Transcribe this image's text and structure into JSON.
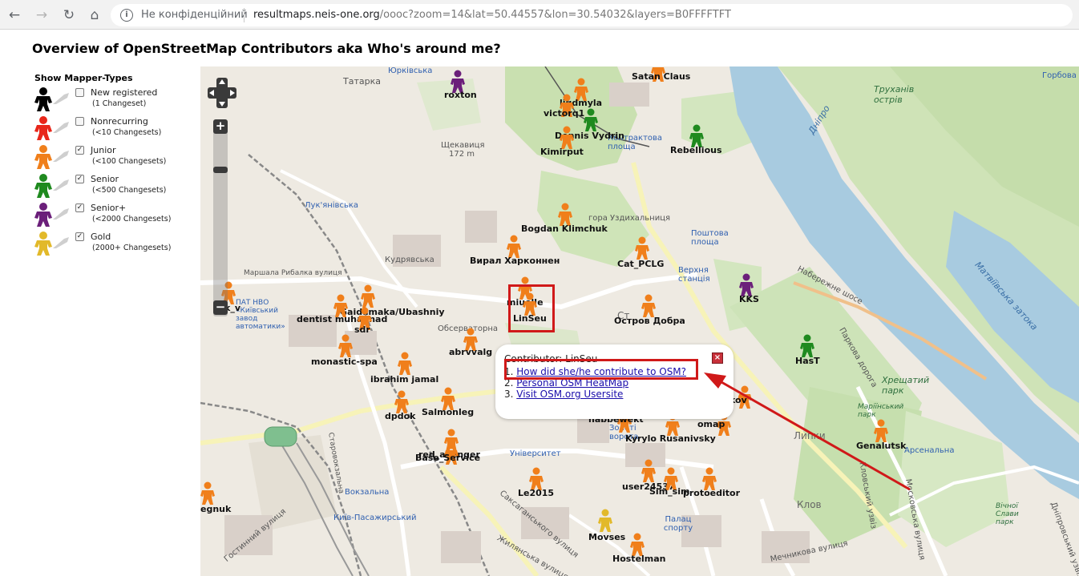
{
  "browser": {
    "back_icon": "←",
    "forward_icon": "→",
    "reload_icon": "↻",
    "home_icon": "⌂",
    "info_icon": "i",
    "security_text": "Не конфіденційний",
    "url_host": "resultmaps.neis-one.org",
    "url_rest": "/oooc?zoom=14&lat=50.44557&lon=30.54032&layers=B0FFFFTFT"
  },
  "page": {
    "title": "Overview of OpenStreetMap Contributors aka Who's around me?"
  },
  "legend": {
    "title": "Show Mapper-Types",
    "items": [
      {
        "label": "New registered",
        "sub": "(1 Changeset)",
        "color": "#000000",
        "checked": ""
      },
      {
        "label": "Nonrecurring",
        "sub": "(<10 Changesets)",
        "color": "#e8261a",
        "checked": ""
      },
      {
        "label": "Junior",
        "sub": "(<100 Changesets)",
        "color": "#f07f1b",
        "checked": "✓"
      },
      {
        "label": "Senior",
        "sub": "(<500 Changesets)",
        "color": "#1f8a1f",
        "checked": "✓"
      },
      {
        "label": "Senior+",
        "sub": "(<2000 Changesets)",
        "color": "#6b1f7a",
        "checked": "✓"
      },
      {
        "label": "Gold",
        "sub": "(2000+ Changesets)",
        "color": "#e2b92a",
        "checked": "✓"
      }
    ]
  },
  "map": {
    "zoom_in": "+",
    "zoom_out": "−",
    "place_labels": [
      "Татарка",
      "Юрківська",
      "Лук'янівська",
      "Кудрявська",
      "Маршала Рибалка вулиця",
      "Обсерваторна",
      "Щекавиця",
      "172 m",
      "гора Уздихальниця",
      "Поштова площа",
      "Верхня станція",
      "Труханів острів",
      "Дніпро",
      "Набережне шосе",
      "Паркова дорога",
      "Хрещатий парк",
      "Маріїнський парк",
      "Липки",
      "Арсенальна",
      "Університет",
      "Вокзальна",
      "Київ-Пасажирський",
      "Палац спорту",
      "Клов",
      "Вічної Слави парк",
      "Контрактова площа",
      "Золоті ворота",
      "Мечникова вулиця",
      "Саксаганського вулиця",
      "Жилянська вулиця",
      "Кловський узвіз",
      "Московська вулиця",
      "Гостинний вулиця",
      "Дніпровський узвіз",
      "Матвіївська затока",
      "Горбова",
      "Ст",
      "ПАТ НВО «Київський завод автоматики»",
      "Старовокзальна"
    ],
    "contributors": [
      {
        "name": "roxton",
        "color": "#6b1f7a"
      },
      {
        "name": "Satan Claus",
        "color": "#f07f1b"
      },
      {
        "name": "liudmyla",
        "color": "#f07f1b"
      },
      {
        "name": "victorq1",
        "color": "#f07f1b"
      },
      {
        "name": "Dennis Vydrin",
        "color": "#1f8a1f"
      },
      {
        "name": "Kimirput",
        "color": "#f07f1b"
      },
      {
        "name": "Rebellious",
        "color": "#1f8a1f"
      },
      {
        "name": "Bogdan Klimchuk",
        "color": "#f07f1b"
      },
      {
        "name": "Вирал Харконнен",
        "color": "#f07f1b"
      },
      {
        "name": "Cat_PCLG",
        "color": "#f07f1b"
      },
      {
        "name": "KKS",
        "color": "#6b1f7a"
      },
      {
        "name": "miuelle",
        "color": "#f07f1b"
      },
      {
        "name": "LinSeu",
        "color": "#f07f1b"
      },
      {
        "name": "Остров Добра",
        "color": "#f07f1b"
      },
      {
        "name": "HasT",
        "color": "#1f8a1f"
      },
      {
        "name": "Gaidamaka/Ubashniy",
        "color": "#f07f1b"
      },
      {
        "name": "dentist muhannad",
        "color": "#f07f1b"
      },
      {
        "name": "sdr",
        "color": "#f07f1b"
      },
      {
        "name": "k_v",
        "color": "#f07f1b"
      },
      {
        "name": "abrvvalg",
        "color": "#f07f1b"
      },
      {
        "name": "monastic-spa",
        "color": "#f07f1b"
      },
      {
        "name": "ibrahim jamal",
        "color": "#f07f1b"
      },
      {
        "name": "dpdok",
        "color": "#f07f1b"
      },
      {
        "name": "Salmonleg",
        "color": "#f07f1b"
      },
      {
        "name": "red_avenger",
        "color": "#f07f1b"
      },
      {
        "name": "Base_Service",
        "color": "#f07f1b"
      },
      {
        "name": "Genalutsk",
        "color": "#f07f1b"
      },
      {
        "name": "Kyrylo Rusanivsky",
        "color": "#f07f1b"
      },
      {
        "name": "omap",
        "color": "#f07f1b"
      },
      {
        "name": "habbewekt",
        "color": "#f07f1b"
      },
      {
        "name": "kov",
        "color": "#f07f1b"
      },
      {
        "name": "Le2015",
        "color": "#f07f1b"
      },
      {
        "name": "user24537",
        "color": "#f07f1b"
      },
      {
        "name": "Sim_sim",
        "color": "#f07f1b"
      },
      {
        "name": "protoeditor",
        "color": "#f07f1b"
      },
      {
        "name": "Movses",
        "color": "#e2b92a"
      },
      {
        "name": "Hostelman",
        "color": "#f07f1b"
      },
      {
        "name": "egnuk",
        "color": "#f07f1b"
      }
    ],
    "popup": {
      "title": "Contributor: LinSeu",
      "close_icon": "×",
      "num1": "1.",
      "link1": "How did she/he contribute to OSM?",
      "num2": "2.",
      "link2": "Personal OSM HeatMap",
      "num3": "3.",
      "link3": "Visit OSM.org Usersite"
    }
  },
  "colors": {
    "annotation_red": "#d01919",
    "junior": "#f07f1b",
    "senior": "#1f8a1f",
    "senior_plus": "#6b1f7a",
    "gold": "#e2b92a",
    "water": "#a8cbe0",
    "park": "#cde3b8"
  }
}
